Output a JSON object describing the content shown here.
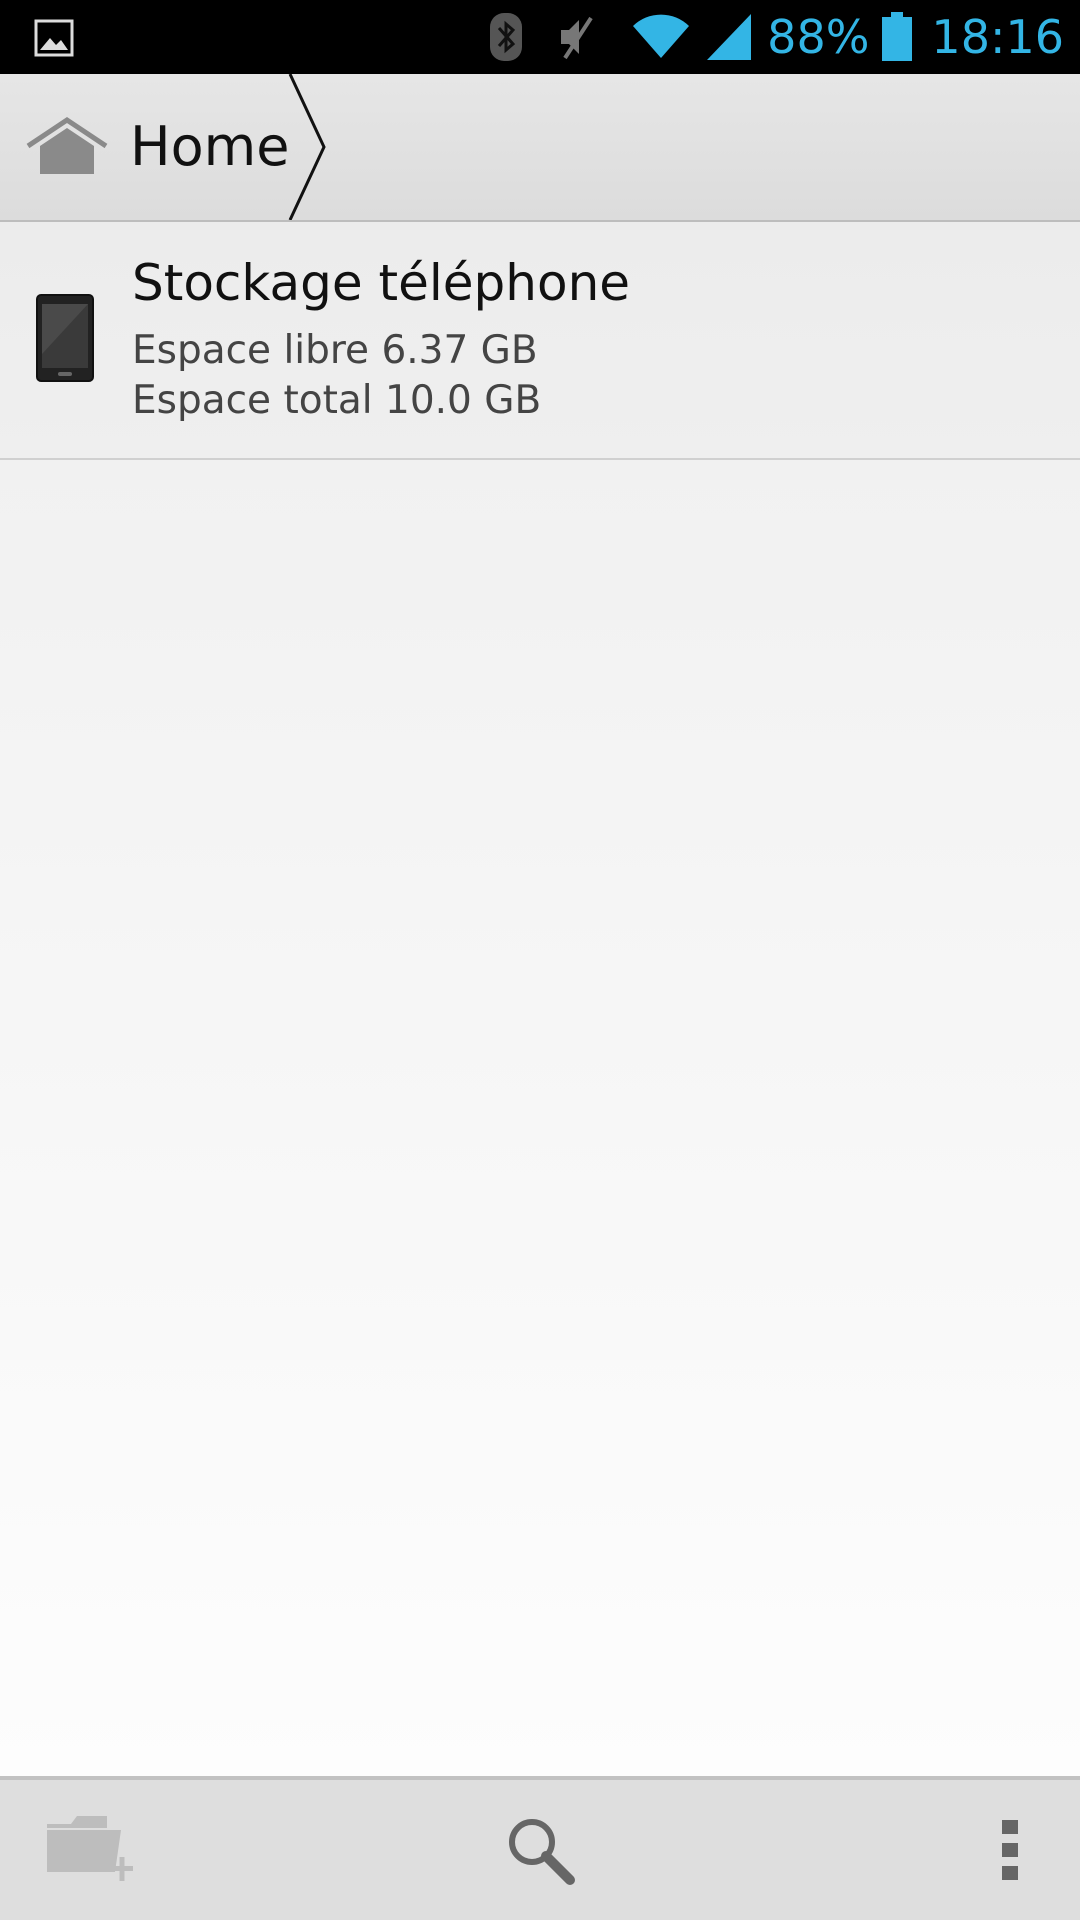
{
  "status_bar": {
    "notification_icon": "image-icon",
    "icons": [
      "bluetooth-icon",
      "mute-icon",
      "wifi-icon",
      "signal-icon",
      "battery-icon"
    ],
    "battery_percent": "88%",
    "time": "18:16",
    "accent_color": "#33b5e5"
  },
  "breadcrumb": {
    "home_icon": "home-icon",
    "label": "Home"
  },
  "storage_list": [
    {
      "icon": "phone-icon",
      "title": "Stockage téléphone",
      "free": "Espace libre 6.37 GB",
      "total": "Espace total 10.0 GB"
    }
  ],
  "action_bar": {
    "new_folder_icon": "new-folder-icon",
    "search_icon": "search-icon",
    "more_icon": "overflow-menu-icon"
  }
}
